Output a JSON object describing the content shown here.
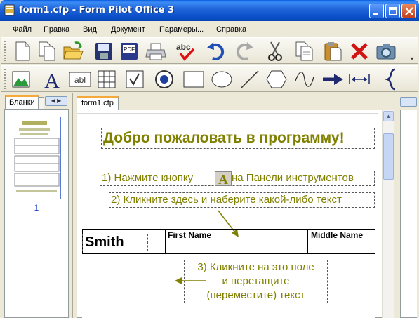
{
  "window": {
    "title": "form1.cfp - Form Pilot Office 3"
  },
  "menu": [
    "Файл",
    "Правка",
    "Вид",
    "Документ",
    "Парамеры...",
    "Справка"
  ],
  "toolbar_main": [
    "new-document",
    "copy-document",
    "open-folder",
    "save",
    "export-pdf",
    "print",
    "spell-check",
    "undo",
    "redo",
    "cut",
    "copy",
    "paste",
    "delete",
    "scan"
  ],
  "toolbar_tools": [
    "image",
    "text",
    "text-field",
    "grid",
    "checkbox",
    "radio-button",
    "rectangle",
    "ellipse",
    "line",
    "hexagon",
    "curve",
    "arrow",
    "dimension",
    "brace"
  ],
  "left_panel": {
    "tab_label": "Бланки",
    "page_number": "1"
  },
  "document": {
    "tab_label": "form1.cfp",
    "heading": "Добро пожаловать в программу!",
    "step1_pre": "1) Нажмите кнопку",
    "step1_post": "на Панели инструментов",
    "step2": "2) Кликните здесь и наберите какой-либо текст",
    "field_first_name": "First Name",
    "field_middle_name": "Middle Name",
    "surname_value": "Smith",
    "step3_line1": "3) Кликните на это поле",
    "step3_line2": "и перетащите",
    "step3_line3": "(переместите) текст"
  },
  "colors": {
    "hint_text": "#808000",
    "title_bar": "#0a4fc8"
  }
}
